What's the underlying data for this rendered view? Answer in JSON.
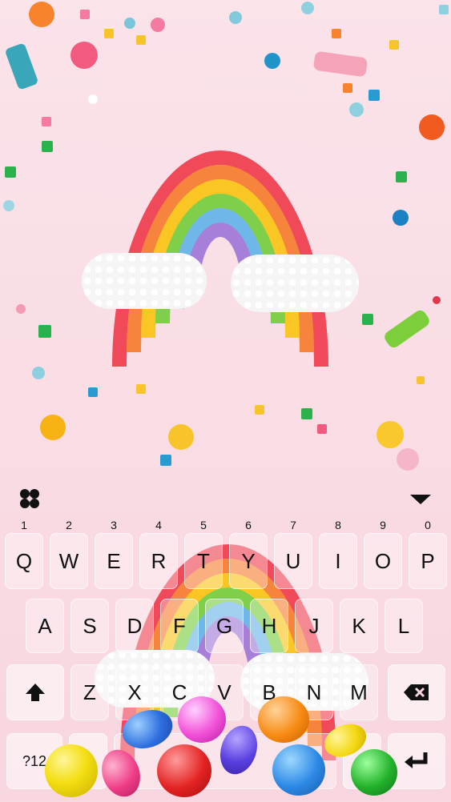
{
  "keyboard": {
    "row1": [
      {
        "label": "Q",
        "hint": "1"
      },
      {
        "label": "W",
        "hint": "2"
      },
      {
        "label": "E",
        "hint": "3"
      },
      {
        "label": "R",
        "hint": "4"
      },
      {
        "label": "T",
        "hint": "5"
      },
      {
        "label": "Y",
        "hint": "6"
      },
      {
        "label": "U",
        "hint": "7"
      },
      {
        "label": "I",
        "hint": "8"
      },
      {
        "label": "O",
        "hint": "9"
      },
      {
        "label": "P",
        "hint": "0"
      }
    ],
    "row2": [
      {
        "label": "A"
      },
      {
        "label": "S"
      },
      {
        "label": "D"
      },
      {
        "label": "F"
      },
      {
        "label": "G"
      },
      {
        "label": "H"
      },
      {
        "label": "J"
      },
      {
        "label": "K"
      },
      {
        "label": "L"
      }
    ],
    "row3": [
      {
        "label": "Z"
      },
      {
        "label": "X"
      },
      {
        "label": "C"
      },
      {
        "label": "V"
      },
      {
        "label": "B"
      },
      {
        "label": "N"
      },
      {
        "label": "M"
      }
    ],
    "symbols_label": "?12",
    "comma_label": ",",
    "period_label": ".",
    "icons": {
      "menu": "four-petal-menu-icon",
      "collapse": "down-triangle-icon",
      "shift": "shift-up-arrow-icon",
      "backspace": "backspace-icon",
      "enter": "enter-return-icon"
    }
  },
  "colors": {
    "background": "#f9d9e1",
    "rainbow": [
      "#f04a5a",
      "#f7843d",
      "#f9c623",
      "#7fcf4a",
      "#6fb7e9",
      "#a77fd8"
    ]
  }
}
